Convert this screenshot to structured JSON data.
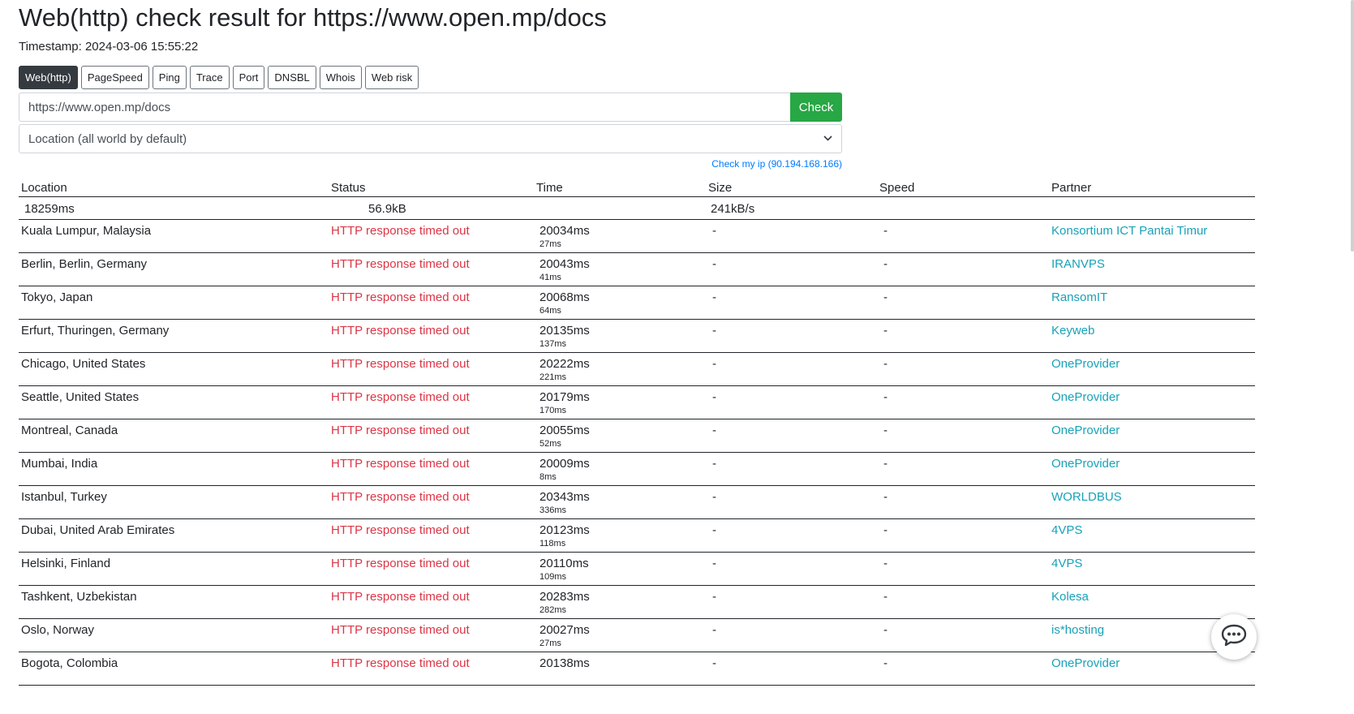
{
  "title": "Web(http) check result for https://www.open.mp/docs",
  "timestamp": "Timestamp: 2024-03-06 15:55:22",
  "tabs": [
    {
      "label": "Web(http)",
      "active": true
    },
    {
      "label": "PageSpeed"
    },
    {
      "label": "Ping"
    },
    {
      "label": "Trace"
    },
    {
      "label": "Port"
    },
    {
      "label": "DNSBL"
    },
    {
      "label": "Whois"
    },
    {
      "label": "Web risk"
    }
  ],
  "url_input": {
    "value": "https://www.open.mp/docs"
  },
  "check_button": "Check",
  "location_select": {
    "selected": "Location (all world by default)"
  },
  "my_ip_link": "Check my ip (90.194.168.166)",
  "table": {
    "headers": {
      "location": "Location",
      "status": "Status",
      "time": "Time",
      "size": "Size",
      "speed": "Speed",
      "partner": "Partner"
    },
    "summary": {
      "time": "18259ms",
      "size": "56.9kB",
      "speed": "241kB/s"
    },
    "rows": [
      {
        "location": "Kuala Lumpur, Malaysia",
        "status": "HTTP response timed out",
        "time": "20034ms",
        "ping": "27ms",
        "size": "-",
        "speed": "-",
        "partner": "Konsortium ICT Pantai Timur"
      },
      {
        "location": "Berlin, Berlin, Germany",
        "status": "HTTP response timed out",
        "time": "20043ms",
        "ping": "41ms",
        "size": "-",
        "speed": "-",
        "partner": "IRANVPS"
      },
      {
        "location": "Tokyo, Japan",
        "status": "HTTP response timed out",
        "time": "20068ms",
        "ping": "64ms",
        "size": "-",
        "speed": "-",
        "partner": "RansomIT"
      },
      {
        "location": "Erfurt, Thuringen, Germany",
        "status": "HTTP response timed out",
        "time": "20135ms",
        "ping": "137ms",
        "size": "-",
        "speed": "-",
        "partner": "Keyweb"
      },
      {
        "location": "Chicago, United States",
        "status": "HTTP response timed out",
        "time": "20222ms",
        "ping": "221ms",
        "size": "-",
        "speed": "-",
        "partner": "OneProvider"
      },
      {
        "location": "Seattle, United States",
        "status": "HTTP response timed out",
        "time": "20179ms",
        "ping": "170ms",
        "size": "-",
        "speed": "-",
        "partner": "OneProvider"
      },
      {
        "location": "Montreal, Canada",
        "status": "HTTP response timed out",
        "time": "20055ms",
        "ping": "52ms",
        "size": "-",
        "speed": "-",
        "partner": "OneProvider"
      },
      {
        "location": "Mumbai, India",
        "status": "HTTP response timed out",
        "time": "20009ms",
        "ping": "8ms",
        "size": "-",
        "speed": "-",
        "partner": "OneProvider"
      },
      {
        "location": "Istanbul, Turkey",
        "status": "HTTP response timed out",
        "time": "20343ms",
        "ping": "336ms",
        "size": "-",
        "speed": "-",
        "partner": "WORLDBUS"
      },
      {
        "location": "Dubai, United Arab Emirates",
        "status": "HTTP response timed out",
        "time": "20123ms",
        "ping": "118ms",
        "size": "-",
        "speed": "-",
        "partner": "4VPS"
      },
      {
        "location": "Helsinki, Finland",
        "status": "HTTP response timed out",
        "time": "20110ms",
        "ping": "109ms",
        "size": "-",
        "speed": "-",
        "partner": "4VPS"
      },
      {
        "location": "Tashkent, Uzbekistan",
        "status": "HTTP response timed out",
        "time": "20283ms",
        "ping": "282ms",
        "size": "-",
        "speed": "-",
        "partner": "Kolesa"
      },
      {
        "location": "Oslo, Norway",
        "status": "HTTP response timed out",
        "time": "20027ms",
        "ping": "27ms",
        "size": "-",
        "speed": "-",
        "partner": "is*hosting"
      },
      {
        "location": "Bogota, Colombia",
        "status": "HTTP response timed out",
        "time": "20138ms",
        "ping": "",
        "size": "-",
        "speed": "-",
        "partner": "OneProvider"
      }
    ]
  },
  "icons": {
    "chat": "chat-icon",
    "select_chevron": "chevron-down-icon"
  },
  "colors": {
    "status_error": "#dc3545",
    "partner_link": "#17a2b8",
    "check_button": "#28a745",
    "active_tab": "#343a40",
    "ip_link": "#007bff"
  }
}
